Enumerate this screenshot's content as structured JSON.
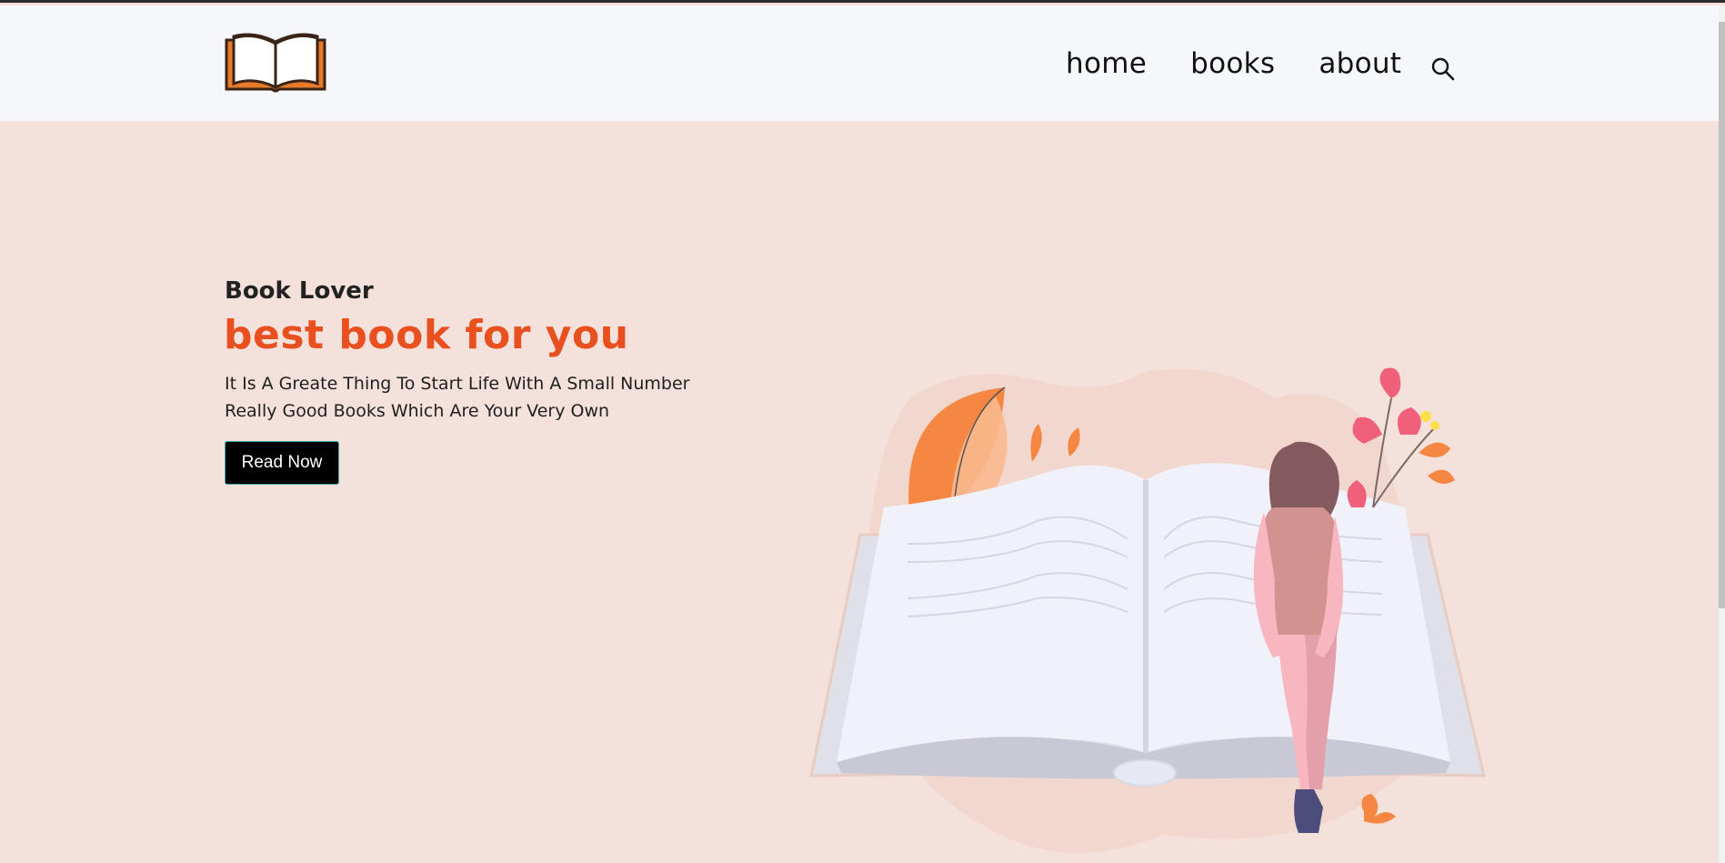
{
  "nav": {
    "items": [
      {
        "label": "home"
      },
      {
        "label": "books"
      },
      {
        "label": "about"
      }
    ],
    "search_icon": "search-icon",
    "logo_icon": "open-book-icon"
  },
  "hero": {
    "subtitle": "Book Lover",
    "title": "best book for you",
    "description_line1": "It Is A Greate Thing To Start Life With A Small Number",
    "description_line2": "Really Good Books Which Are Your Very Own",
    "button_label": "Read Now",
    "illustration": "woman-reading-open-book-illustration"
  },
  "colors": {
    "accent": "#e8501f",
    "background": "#f4e1db",
    "header_bg": "#f5f7fa",
    "button_bg": "#000000"
  }
}
